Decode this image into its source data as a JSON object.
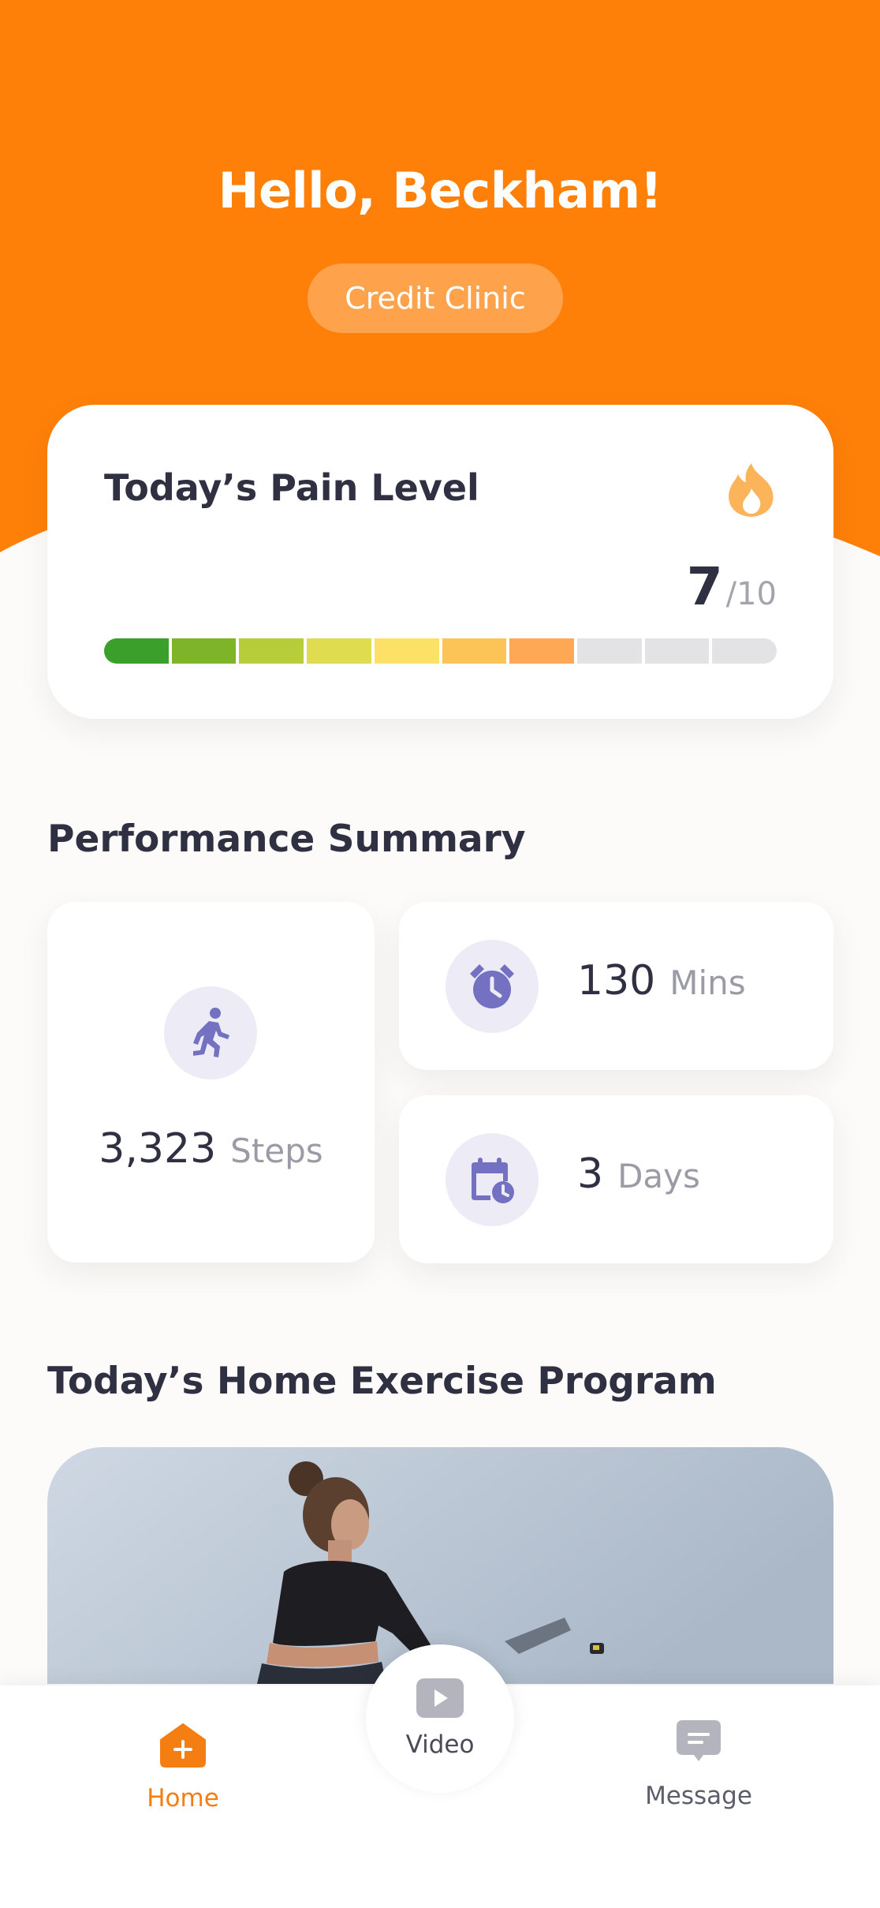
{
  "header": {
    "greeting": "Hello, Beckham!",
    "clinic_label": "Credit Clinic",
    "background_color": "#fe8008"
  },
  "pain_card": {
    "title": "Today’s Pain Level",
    "icon": "flame-icon",
    "score": "7",
    "max": "/10",
    "level": 7,
    "scale_max": 10,
    "segment_colors": [
      "#3a9f2b",
      "#7db428",
      "#b7cd3a",
      "#dfdc50",
      "#fde066",
      "#fcc457",
      "#fea855",
      "#e3e3e6",
      "#e3e3e6",
      "#e3e3e6"
    ]
  },
  "performance": {
    "title": "Performance Summary",
    "steps": {
      "value": "3,323",
      "unit": "Steps",
      "icon": "running-person-icon"
    },
    "minutes": {
      "value": "130",
      "unit": "Mins",
      "icon": "alarm-clock-icon"
    },
    "days": {
      "value": "3",
      "unit": "Days",
      "icon": "calendar-clock-icon"
    },
    "icon_color": "#7470c2"
  },
  "exercise": {
    "title": "Today’s Home Exercise Program",
    "image": "woman-exercising-photo"
  },
  "tabbar": {
    "home": "Home",
    "video": "Video",
    "message": "Message",
    "active_tab": "Home",
    "active_color": "#f47e12"
  }
}
